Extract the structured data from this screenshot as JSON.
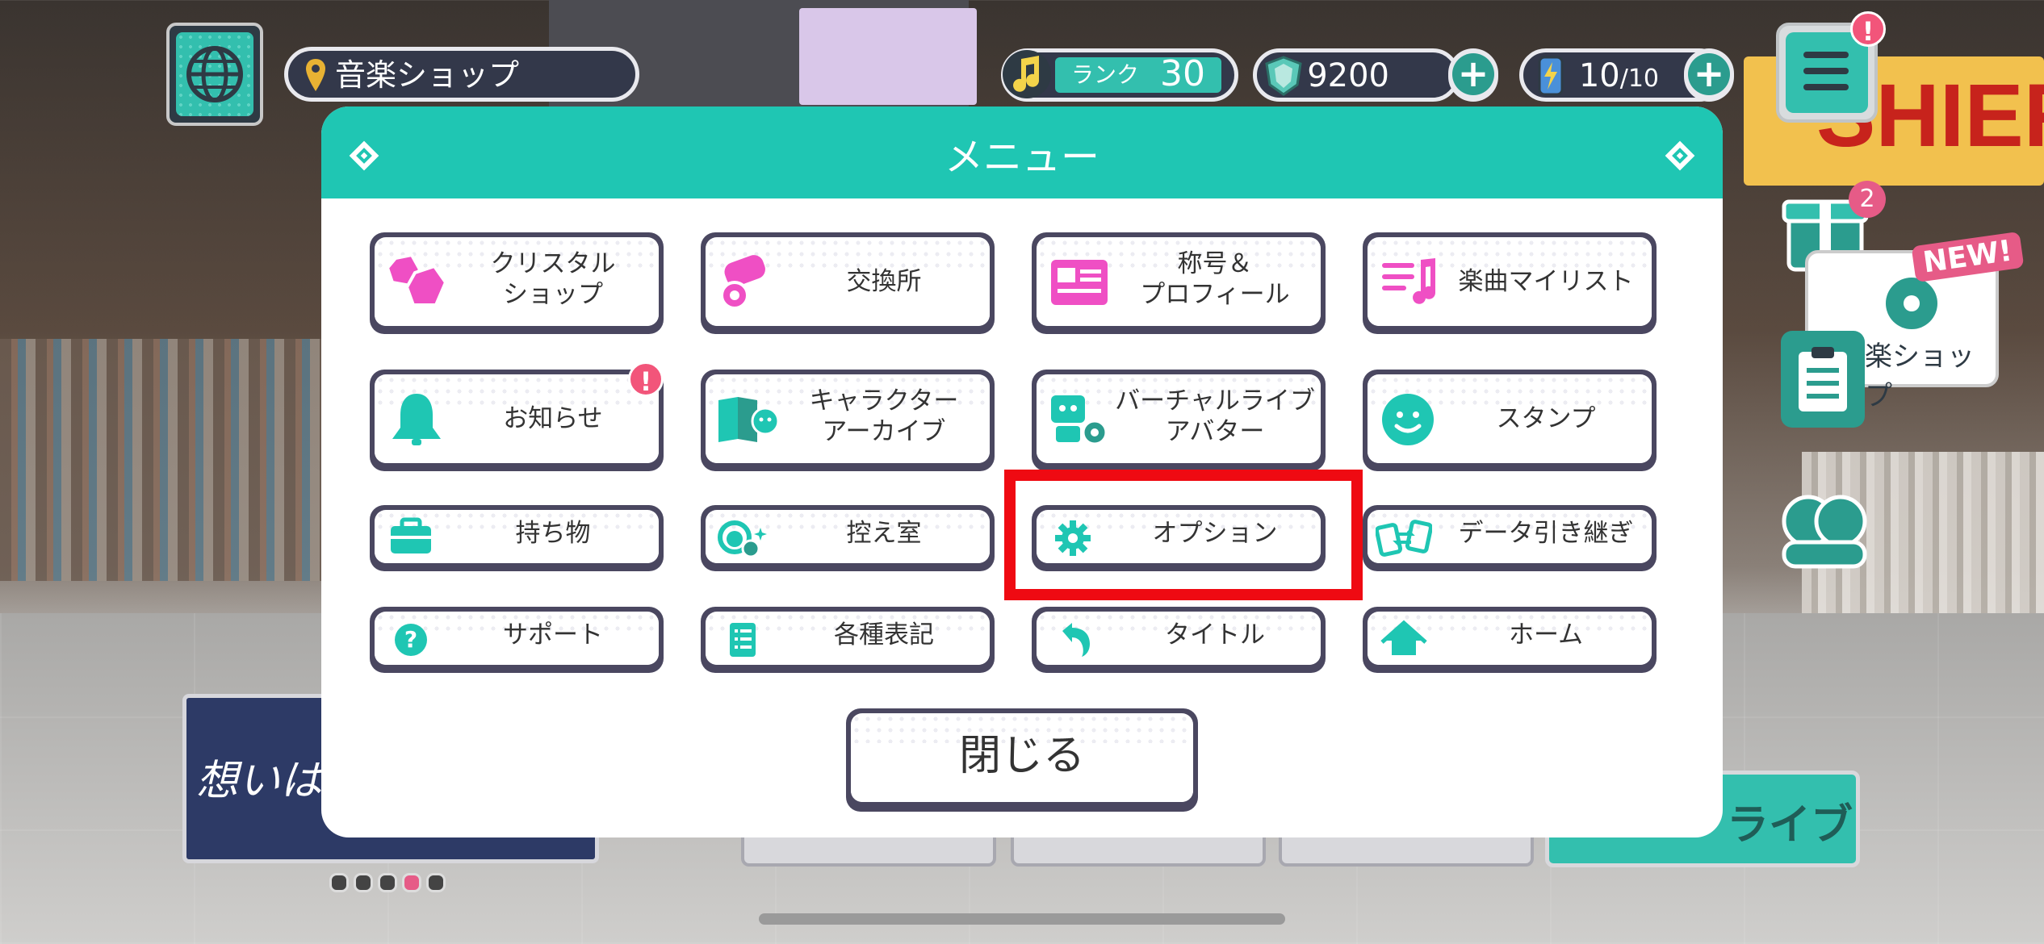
{
  "topbar": {
    "location": "音楽ショップ",
    "rank_label": "ランク",
    "rank_value": "30",
    "crystals": "9200",
    "energy_current": "10",
    "energy_max": "/10",
    "plus": "+",
    "menu_alert": "!"
  },
  "side": {
    "gift_badge": "2",
    "new_label": "NEW!",
    "shop_label": "楽ショップ"
  },
  "background": {
    "cashier_text": "SHIER",
    "banner_text": "想いは　Shooting",
    "live_text": "ライブ"
  },
  "modal": {
    "title": "メニュー",
    "buttons": [
      {
        "label": "クリスタル\nショップ",
        "icon": "crystal-icon"
      },
      {
        "label": "交換所",
        "icon": "exchange-icon"
      },
      {
        "label": "称号＆\nプロフィール",
        "icon": "profile-card-icon"
      },
      {
        "label": "楽曲マイリスト",
        "icon": "music-list-icon"
      },
      {
        "label": "お知らせ",
        "icon": "bell-icon",
        "alert": "!"
      },
      {
        "label": "キャラクター\nアーカイブ",
        "icon": "character-archive-icon"
      },
      {
        "label": "バーチャルライブ\nアバター",
        "icon": "avatar-gear-icon"
      },
      {
        "label": "スタンプ",
        "icon": "smile-icon"
      },
      {
        "label": "持ち物",
        "icon": "briefcase-icon"
      },
      {
        "label": "控え室",
        "icon": "waiting-room-icon"
      },
      {
        "label": "オプション",
        "icon": "gear-icon"
      },
      {
        "label": "データ引き継ぎ",
        "icon": "data-transfer-icon"
      },
      {
        "label": "サポート",
        "icon": "question-icon"
      },
      {
        "label": "各種表記",
        "icon": "document-list-icon"
      },
      {
        "label": "タイトル",
        "icon": "return-arrow-icon"
      },
      {
        "label": "ホーム",
        "icon": "home-icon"
      }
    ],
    "close_label": "閉じる"
  },
  "colors": {
    "accent": "#1fc6b3",
    "highlight": "#ef0a12",
    "alert": "#f2557a"
  }
}
